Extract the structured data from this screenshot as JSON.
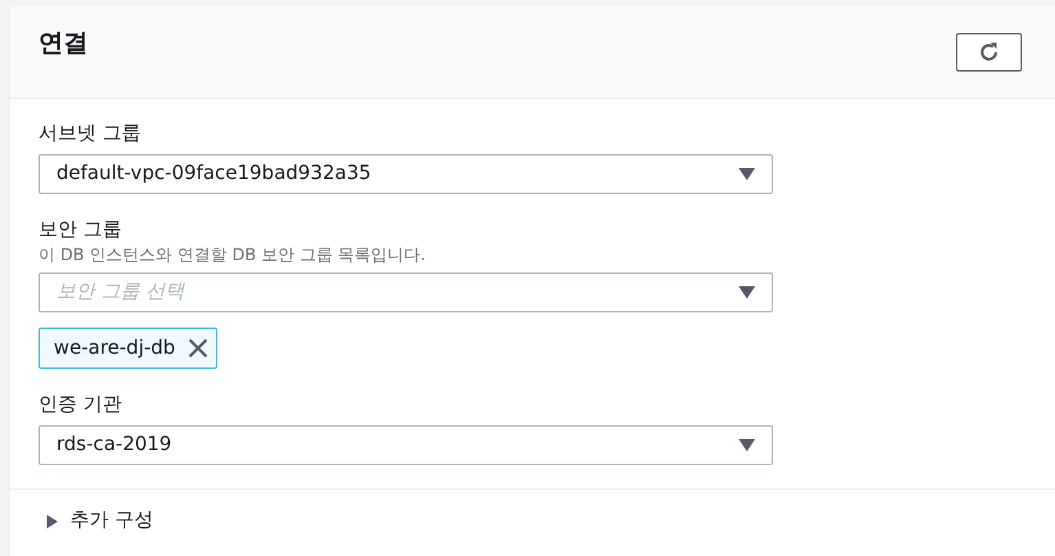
{
  "panel": {
    "title": "연결"
  },
  "fields": [
    {
      "kind": "select",
      "label": "서브넷 그룹",
      "value": "default-vpc-09face19bad932a35"
    },
    {
      "kind": "multiselect",
      "label": "보안 그룹",
      "description": "이 DB 인스턴스와 연결할 DB 보안 그룹 목록입니다.",
      "placeholder": "보안 그룹 선택",
      "tokens": [
        "we-are-dj-db"
      ]
    },
    {
      "kind": "select",
      "label": "인증 기관",
      "value": "rds-ca-2019"
    }
  ],
  "additional": {
    "label": "추가 구성",
    "expanded": false
  }
}
